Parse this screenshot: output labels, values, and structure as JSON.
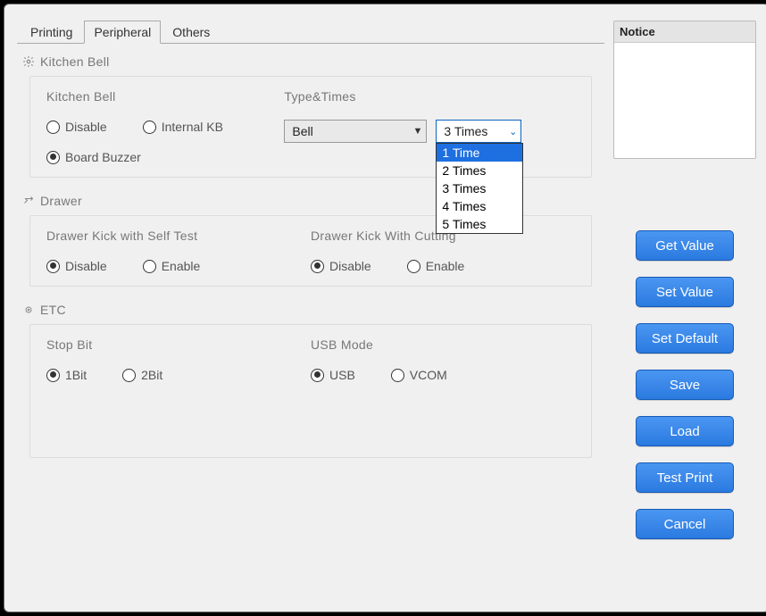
{
  "tabs": {
    "printing": "Printing",
    "peripheral": "Peripheral",
    "others": "Others"
  },
  "sections": {
    "kitchen_bell": {
      "header": "Kitchen Bell",
      "group1_title": "Kitchen Bell",
      "group2_title": "Type&Times",
      "radios": {
        "disable": "Disable",
        "internal_kb": "Internal KB",
        "board_buzzer": "Board Buzzer"
      },
      "bell_select": "Bell",
      "times_select": "3 Times",
      "times_options": [
        "1 Time",
        "2 Times",
        "3 Times",
        "4 Times",
        "5 Times"
      ]
    },
    "drawer": {
      "header": "Drawer",
      "group1_title": "Drawer Kick with Self Test",
      "group2_title": "Drawer Kick With Cutting",
      "disable": "Disable",
      "enable": "Enable"
    },
    "etc": {
      "header": "ETC",
      "group1_title": "Stop Bit",
      "group2_title": "USB Mode",
      "bit1": "1Bit",
      "bit2": "2Bit",
      "usb": "USB",
      "vcom": "VCOM"
    }
  },
  "notice": {
    "header": "Notice"
  },
  "buttons": {
    "get_value": "Get Value",
    "set_value": "Set Value",
    "set_default": "Set Default",
    "save": "Save",
    "load": "Load",
    "test_print": "Test Print",
    "cancel": "Cancel"
  }
}
